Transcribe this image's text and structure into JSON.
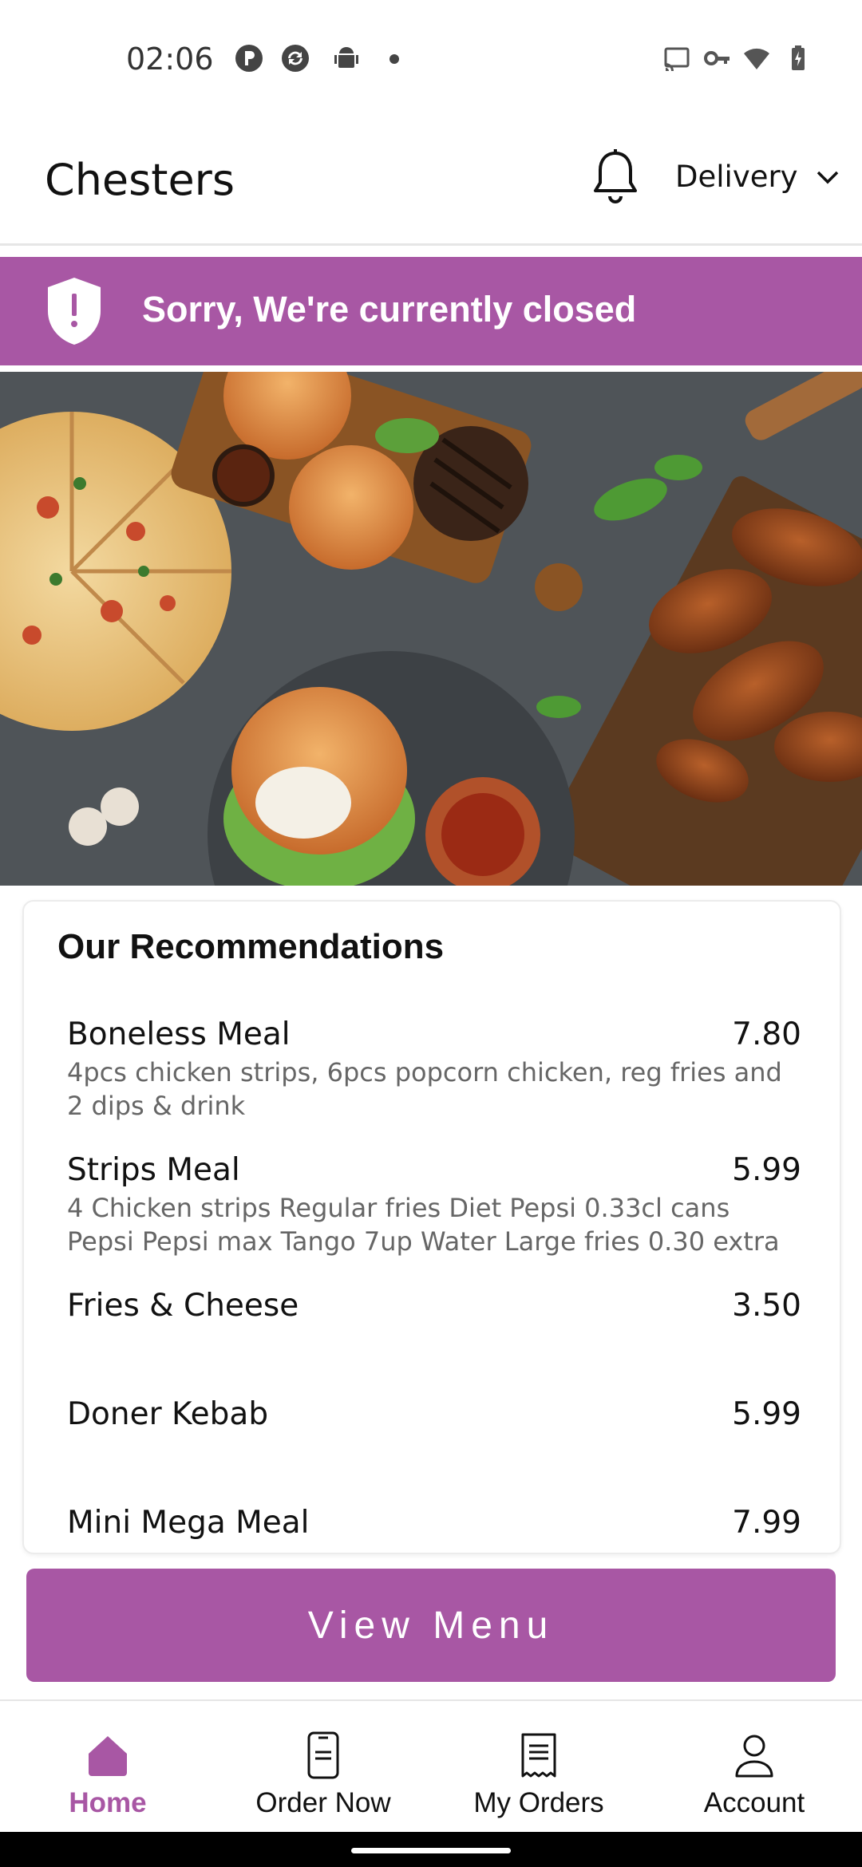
{
  "status_bar": {
    "time": "02:06",
    "icons": [
      "p-circle-icon",
      "sync-icon",
      "android-icon",
      "dot-icon",
      "cast-icon",
      "vpn-key-icon",
      "wifi-icon",
      "battery-charging-icon"
    ]
  },
  "header": {
    "title": "Chesters",
    "mode_label": "Delivery",
    "icons": [
      "bell-icon",
      "chevron-down-icon"
    ]
  },
  "banner": {
    "text": "Sorry, We're currently closed",
    "icon": "shield-alert-icon",
    "color": "#a857a4"
  },
  "hero": {
    "icon": "food-photo"
  },
  "recommendations": {
    "title": "Our Recommendations",
    "items": [
      {
        "name": "Boneless Meal",
        "price": "7.80",
        "description": "4pcs chicken strips, 6pcs popcorn chicken, reg fries and 2 dips & drink"
      },
      {
        "name": "Strips Meal",
        "price": "5.99",
        "description": "4 Chicken strips  Regular fries  Diet Pepsi  0.33cl cans Pepsi Pepsi max  Tango  7up  Water   Large fries 0.30 extra"
      },
      {
        "name": "Fries & Cheese",
        "price": "3.50",
        "description": ""
      },
      {
        "name": "Doner Kebab",
        "price": "5.99",
        "description": ""
      },
      {
        "name": "Mini Mega Meal",
        "price": "7.99",
        "description": ""
      }
    ]
  },
  "view_menu": {
    "label": "View Menu"
  },
  "bottom_nav": {
    "active_color": "#a857a4",
    "items": [
      {
        "label": "Home",
        "icon": "home-icon",
        "active": true
      },
      {
        "label": "Order Now",
        "icon": "phone-order-icon",
        "active": false
      },
      {
        "label": "My Orders",
        "icon": "receipt-icon",
        "active": false
      },
      {
        "label": "Account",
        "icon": "user-icon",
        "active": false
      }
    ]
  }
}
